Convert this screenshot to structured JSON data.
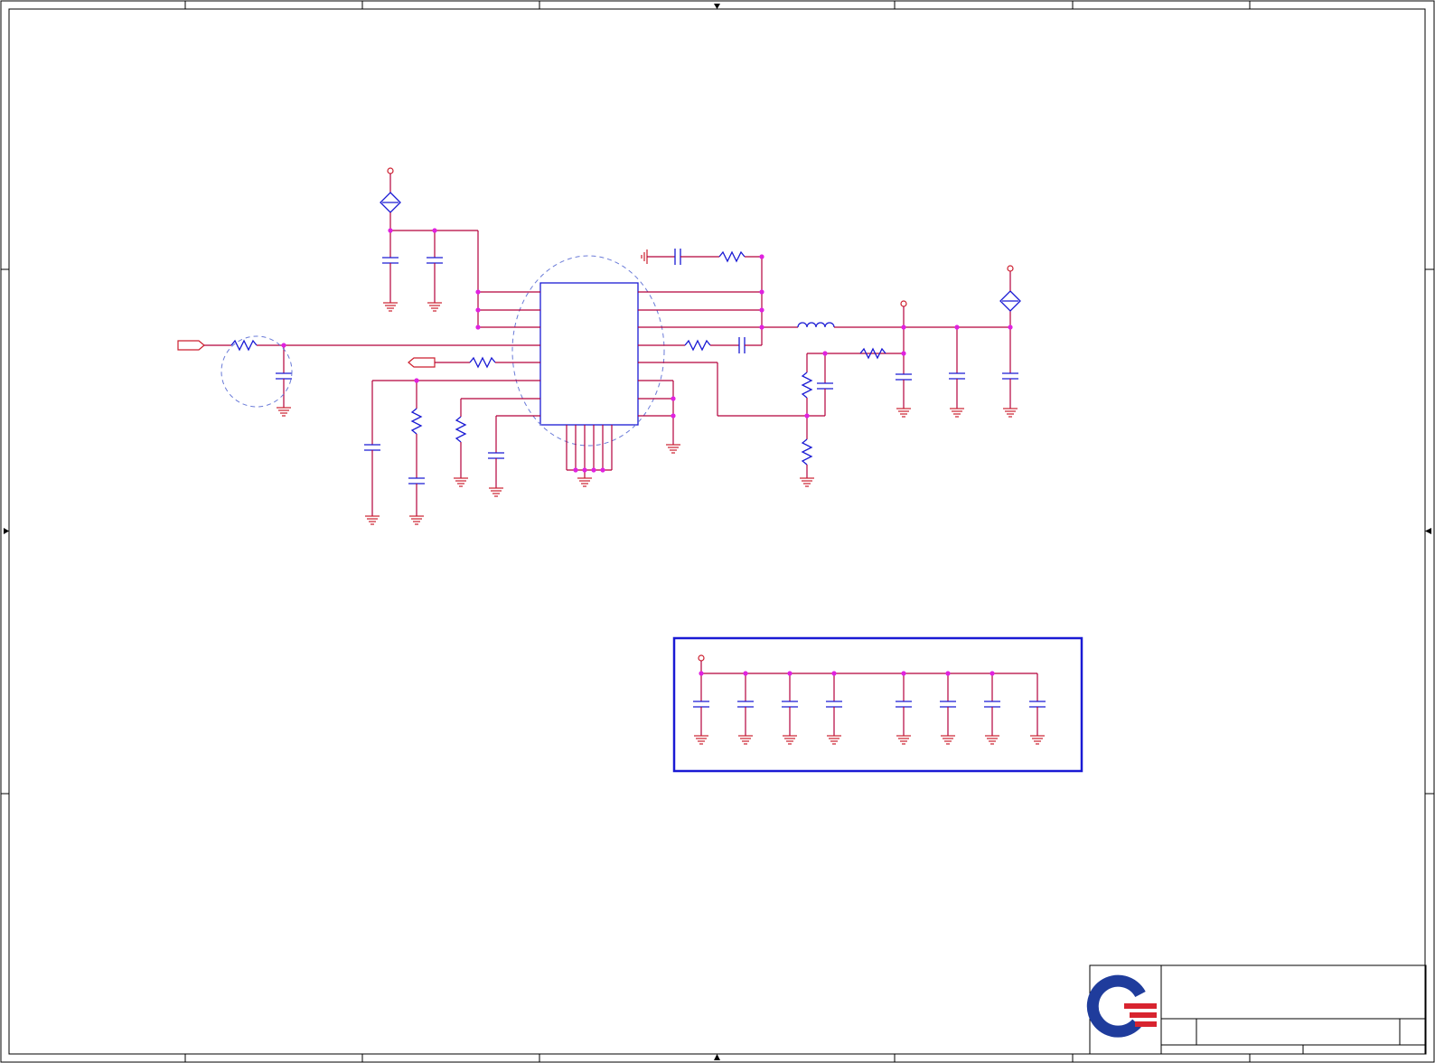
{
  "window": {
    "title": ""
  },
  "schematic": {
    "grid_columns": 8,
    "grid_rows": 4,
    "colors": {
      "wire": "#b3003b",
      "component": "#1a1ad4",
      "ground": "#cc1f2e",
      "junction": "#e022e0",
      "border": "#000000",
      "logo_blue": "#1f3c9c",
      "logo_red": "#d8242f"
    },
    "symbols": [
      "resistor-icon",
      "capacitor-icon",
      "inductor-icon",
      "ground-icon",
      "power-flag-icon",
      "net-port-icon",
      "ic-package-icon",
      "junction-dot-icon"
    ]
  },
  "title_block": {
    "logo": "company-logo-icon",
    "company": "",
    "title": "",
    "size": "",
    "document_number": "",
    "rev": "",
    "date": "",
    "sheet": ""
  }
}
